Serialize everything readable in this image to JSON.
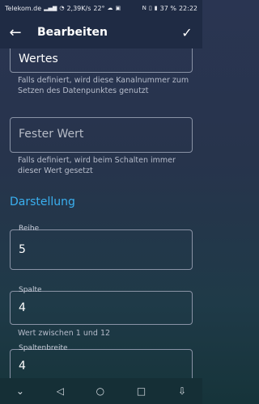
{
  "status": {
    "carrier": "Telekom.de",
    "net_speed": "2,39K/s",
    "temp": "22°",
    "battery": "37 %",
    "time": "22:22"
  },
  "appbar": {
    "title": "Bearbeiten",
    "back_icon": "arrow-left-icon",
    "save_icon": "check-icon"
  },
  "fields": {
    "channel_value_label_partial": "Wertes",
    "channel_help": "Falls definiert, wird diese Kanalnummer zum Setzen des Datenpunktes genutzt",
    "fixed_value_placeholder": "Fester Wert",
    "fixed_value_help": "Falls definiert, wird beim Schalten immer dieser Wert gesetzt"
  },
  "section_display": "Darstellung",
  "row": {
    "label": "Reihe",
    "value": "5"
  },
  "column": {
    "label": "Spalte",
    "value": "4",
    "help": "Wert zwischen 1 und 12"
  },
  "column_width": {
    "label": "Spaltenbreite",
    "value": "4"
  },
  "nav": {
    "icons": [
      "chevron-down-icon",
      "back-triangle-icon",
      "home-circle-icon",
      "recents-square-icon",
      "download-tray-icon"
    ]
  }
}
